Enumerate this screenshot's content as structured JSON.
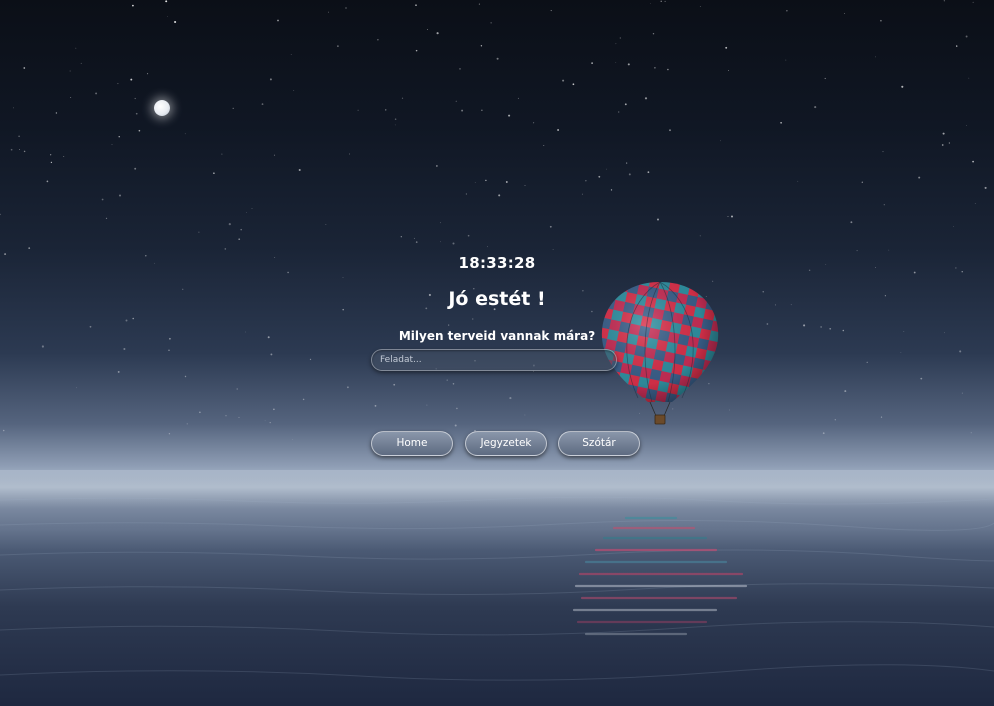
{
  "clock": {
    "time": "18:33:28"
  },
  "greeting": {
    "text": "Jó estét !"
  },
  "task_prompt": {
    "question": "Milyen terveid vannak mára?",
    "placeholder": "Feladat..."
  },
  "nav": {
    "buttons": [
      {
        "label": "Home"
      },
      {
        "label": "Jegyzetek"
      },
      {
        "label": "Szótár"
      }
    ]
  },
  "background": {
    "icons": [
      "moon-icon",
      "hot-air-balloon-icon"
    ],
    "balloon_colors": [
      "#d8304a",
      "#2f8fa0",
      "#3a5f8a"
    ]
  }
}
